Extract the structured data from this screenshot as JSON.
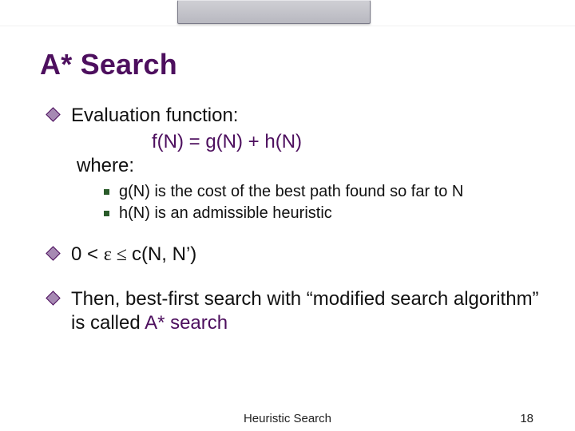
{
  "slide": {
    "title": "A* Search",
    "eval_label": "Evaluation function:",
    "formula": "f(N) = g(N) + h(N)",
    "where_label": "where:",
    "defs": [
      "g(N) is the cost of the best path found so far to N",
      "h(N) is an admissible heuristic"
    ],
    "inequality_prefix": "0 < ",
    "inequality_eps": "ε",
    "inequality_le": " ≤ ",
    "inequality_rhs": "c(N, N’)",
    "conclusion_pre": "Then, best-first search with “modified search algorithm” is called ",
    "conclusion_accent": "A* search"
  },
  "footer": {
    "label": "Heuristic Search",
    "page": "18"
  }
}
